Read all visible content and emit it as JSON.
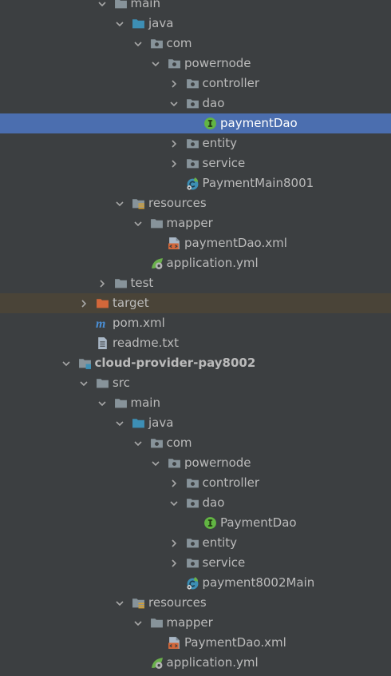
{
  "tree": {
    "rows": [
      {
        "label": "main",
        "depth": 5,
        "arrow": "down",
        "icon": "folder-icon",
        "state": ""
      },
      {
        "label": "java",
        "depth": 6,
        "arrow": "down",
        "icon": "source-folder-icon",
        "state": ""
      },
      {
        "label": "com",
        "depth": 7,
        "arrow": "down",
        "icon": "package-icon",
        "state": ""
      },
      {
        "label": "powernode",
        "depth": 8,
        "arrow": "down",
        "icon": "package-icon",
        "state": ""
      },
      {
        "label": "controller",
        "depth": 9,
        "arrow": "right",
        "icon": "package-icon",
        "state": ""
      },
      {
        "label": "dao",
        "depth": 9,
        "arrow": "down",
        "icon": "package-icon",
        "state": ""
      },
      {
        "label": "paymentDao",
        "depth": 10,
        "arrow": "none",
        "icon": "interface-icon",
        "state": "selected"
      },
      {
        "label": "entity",
        "depth": 9,
        "arrow": "right",
        "icon": "package-icon",
        "state": ""
      },
      {
        "label": "service",
        "depth": 9,
        "arrow": "right",
        "icon": "package-icon",
        "state": ""
      },
      {
        "label": "PaymentMain8001",
        "depth": 9,
        "arrow": "none",
        "icon": "spring-boot-class-icon",
        "state": ""
      },
      {
        "label": "resources",
        "depth": 6,
        "arrow": "down",
        "icon": "resources-folder-icon",
        "state": ""
      },
      {
        "label": "mapper",
        "depth": 7,
        "arrow": "down",
        "icon": "folder-icon",
        "state": ""
      },
      {
        "label": "paymentDao.xml",
        "depth": 8,
        "arrow": "none",
        "icon": "xml-file-icon",
        "state": ""
      },
      {
        "label": "application.yml",
        "depth": 7,
        "arrow": "none",
        "icon": "yaml-config-icon",
        "state": ""
      },
      {
        "label": "test",
        "depth": 5,
        "arrow": "right",
        "icon": "folder-icon",
        "state": ""
      },
      {
        "label": "target",
        "depth": 4,
        "arrow": "right",
        "icon": "excluded-folder-icon",
        "state": "excluded"
      },
      {
        "label": "pom.xml",
        "depth": 4,
        "arrow": "none",
        "icon": "maven-icon",
        "state": ""
      },
      {
        "label": "readme.txt",
        "depth": 4,
        "arrow": "none",
        "icon": "text-file-icon",
        "state": ""
      },
      {
        "label": "cloud-provider-pay8002",
        "depth": 3,
        "arrow": "down",
        "icon": "module-icon",
        "state": "bold"
      },
      {
        "label": "src",
        "depth": 4,
        "arrow": "down",
        "icon": "folder-icon",
        "state": ""
      },
      {
        "label": "main",
        "depth": 5,
        "arrow": "down",
        "icon": "folder-icon",
        "state": ""
      },
      {
        "label": "java",
        "depth": 6,
        "arrow": "down",
        "icon": "source-folder-icon",
        "state": ""
      },
      {
        "label": "com",
        "depth": 7,
        "arrow": "down",
        "icon": "package-icon",
        "state": ""
      },
      {
        "label": "powernode",
        "depth": 8,
        "arrow": "down",
        "icon": "package-icon",
        "state": ""
      },
      {
        "label": "controller",
        "depth": 9,
        "arrow": "right",
        "icon": "package-icon",
        "state": ""
      },
      {
        "label": "dao",
        "depth": 9,
        "arrow": "down",
        "icon": "package-icon",
        "state": ""
      },
      {
        "label": "PaymentDao",
        "depth": 10,
        "arrow": "none",
        "icon": "interface-icon",
        "state": ""
      },
      {
        "label": "entity",
        "depth": 9,
        "arrow": "right",
        "icon": "package-icon",
        "state": ""
      },
      {
        "label": "service",
        "depth": 9,
        "arrow": "right",
        "icon": "package-icon",
        "state": ""
      },
      {
        "label": "payment8002Main",
        "depth": 9,
        "arrow": "none",
        "icon": "spring-boot-class-icon",
        "state": ""
      },
      {
        "label": "resources",
        "depth": 6,
        "arrow": "down",
        "icon": "resources-folder-icon",
        "state": ""
      },
      {
        "label": "mapper",
        "depth": 7,
        "arrow": "down",
        "icon": "folder-icon",
        "state": ""
      },
      {
        "label": "PaymentDao.xml",
        "depth": 8,
        "arrow": "none",
        "icon": "xml-file-icon",
        "state": ""
      },
      {
        "label": "application.yml",
        "depth": 7,
        "arrow": "none",
        "icon": "yaml-config-icon",
        "state": ""
      }
    ]
  },
  "colors": {
    "background": "#3c3f41",
    "text": "#bbbbbb",
    "selection": "#4b6eaf",
    "excluded_row": "#4a4438",
    "folder": "#87939a",
    "source_folder": "#3d8fb5",
    "excluded_folder": "#d3673a",
    "interface_badge": "#62b543",
    "maven": "#4a8fd6"
  }
}
